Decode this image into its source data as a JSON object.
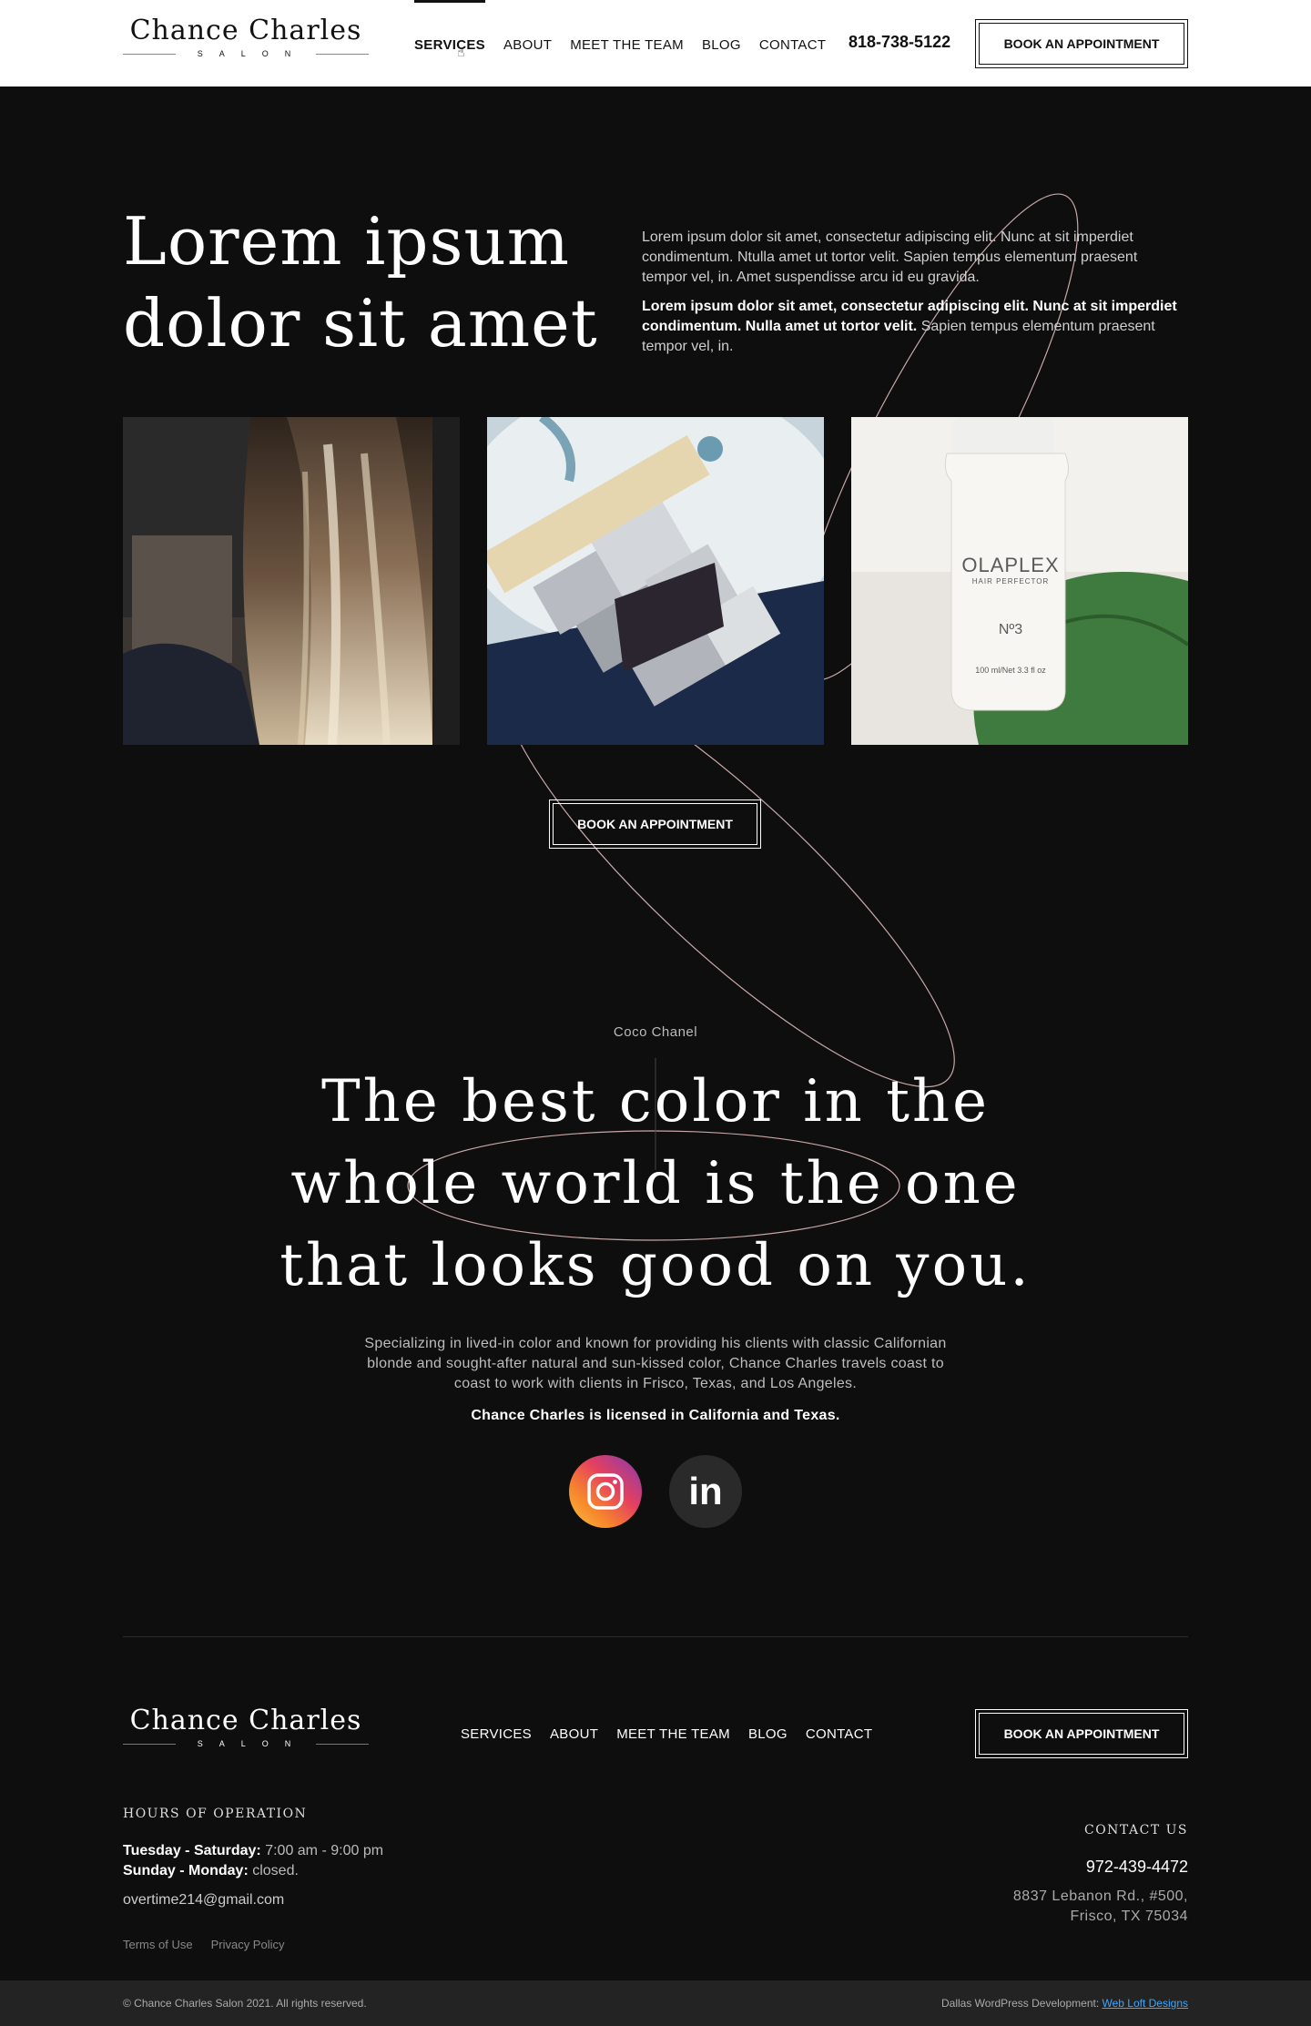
{
  "header": {
    "logo_name": "Chance Charles",
    "logo_sub": "SALON",
    "nav": [
      "SERVICES",
      "ABOUT",
      "MEET THE TEAM",
      "BLOG",
      "CONTACT"
    ],
    "phone": "818-738-5122",
    "cta": "BOOK AN APPOINTMENT"
  },
  "hero": {
    "title_line1": "Lorem ipsum",
    "title_line2": "dolor sit amet",
    "paragraph1": "Lorem ipsum dolor sit amet, consectetur adipiscing elit. Nunc at sit imperdiet condimentum. Ntulla amet ut tortor velit. Sapien tempus elementum praesent tempor vel, in. Amet suspendisse arcu id eu gravida.",
    "paragraph2_bold": "Lorem ipsum dolor sit amet, consectetur adipiscing elit. Nunc at sit imperdiet condimentum. Nulla amet ut tortor velit.",
    "paragraph2_rest": " Sapien tempus elementum praesent tempor vel, in.",
    "cta": "BOOK AN APPOINTMENT",
    "bottle_brand": "OLAPLEX",
    "bottle_sub": "HAIR PERFECTOR",
    "bottle_no": "Nº3",
    "bottle_size": "100 ml/Net 3.3 fl oz"
  },
  "quote": {
    "author": "Coco Chanel",
    "line1": "The best color in the",
    "line2": "whole world is the one",
    "line3": "that looks good on you.",
    "body": "Specializing in lived-in color and known for providing his clients with classic Californian blonde and sought-after natural and sun-kissed color, Chance Charles travels coast to coast to work with clients in Frisco, Texas, and Los Angeles.",
    "strong": "Chance Charles is licensed in California and Texas.",
    "social_icons": [
      "instagram-icon",
      "linkedin-icon"
    ],
    "linkedin_label": "in"
  },
  "footer": {
    "logo_name": "Chance Charles",
    "logo_sub": "SALON",
    "nav": [
      "SERVICES",
      "ABOUT",
      "MEET THE TEAM",
      "BLOG",
      "CONTACT"
    ],
    "cta": "BOOK AN APPOINTMENT",
    "hours_title": "HOURS OF OPERATION",
    "hours_day1": "Tuesday - Saturday:",
    "hours_time1": " 7:00 am - 9:00 pm",
    "hours_day2": "Sunday - Monday:",
    "hours_time2": " closed.",
    "email": "overtime214@gmail.com",
    "terms": "Terms of Use",
    "privacy": "Privacy Policy",
    "contact_title": "CONTACT US",
    "contact_phone": "972-439-4472",
    "address1": "8837 Lebanon Rd., #500,",
    "address2": "Frisco, TX 75034",
    "copyright": "© Chance Charles Salon 2021. All rights reserved.",
    "credit_prefix": "Dallas WordPress Development: ",
    "credit_link": "Web Loft Designs"
  },
  "colors": {
    "background": "#0e0e0e",
    "header_bg": "#ffffff",
    "accent_line": "#c9a7a7",
    "link": "#3ba7ff"
  }
}
